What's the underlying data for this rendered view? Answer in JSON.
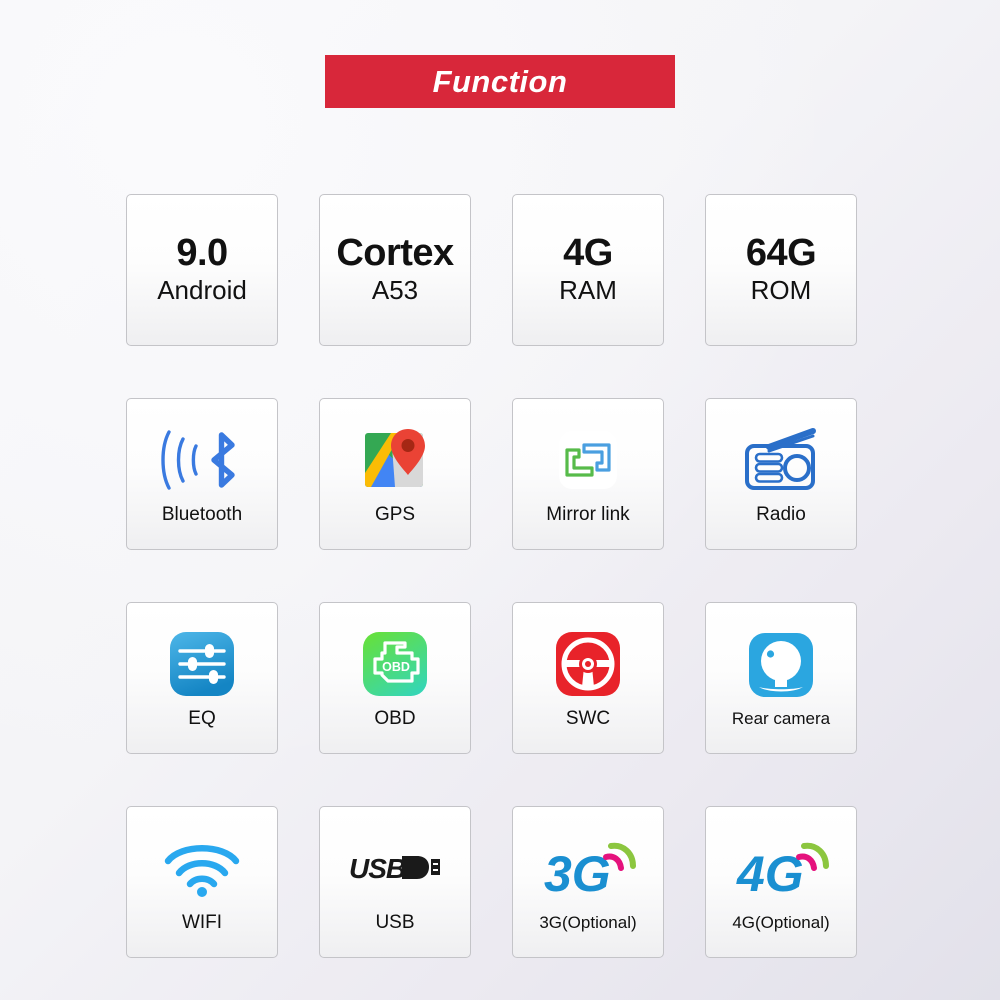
{
  "banner": {
    "title": "Function",
    "color": "#d8273a",
    "text_color": "#ffffff"
  },
  "page": {
    "background_from": "#f7f7f9",
    "background_to": "#e2e1ea",
    "card_border": "#c4c4c8"
  },
  "grid": {
    "columns": 4,
    "rows": 4,
    "cards": [
      {
        "kind": "text",
        "icon": "none",
        "big": "9.0",
        "sub": "Android",
        "label": ""
      },
      {
        "kind": "text",
        "icon": "none",
        "big": "Cortex",
        "sub": "A53",
        "label": ""
      },
      {
        "kind": "text",
        "icon": "none",
        "big": "4G",
        "sub": "RAM",
        "label": ""
      },
      {
        "kind": "text",
        "icon": "none",
        "big": "64G",
        "sub": "ROM",
        "label": ""
      },
      {
        "kind": "icon",
        "icon": "bluetooth-icon",
        "label": "Bluetooth",
        "color": "#3a7ae0"
      },
      {
        "kind": "icon",
        "icon": "gps-map-pin-icon",
        "label": "GPS",
        "color": "#34a853"
      },
      {
        "kind": "icon",
        "icon": "mirror-link-icon",
        "label": "Mirror link",
        "color": "#4a9fe0"
      },
      {
        "kind": "icon",
        "icon": "radio-icon",
        "label": "Radio",
        "color": "#2a6fc9"
      },
      {
        "kind": "icon",
        "icon": "eq-sliders-icon",
        "label": "EQ",
        "color": "#3fa9dd"
      },
      {
        "kind": "icon",
        "icon": "obd-engine-icon",
        "label": "OBD",
        "color": "#4ed760"
      },
      {
        "kind": "icon",
        "icon": "steering-wheel-icon",
        "label": "SWC",
        "color": "#e8232a"
      },
      {
        "kind": "icon",
        "icon": "rear-camera-icon",
        "label": "Rear camera",
        "color": "#2ba6e0"
      },
      {
        "kind": "icon",
        "icon": "wifi-icon",
        "label": "WIFI",
        "color": "#29a8ef"
      },
      {
        "kind": "icon",
        "icon": "usb-logo-icon",
        "label": "USB",
        "color": "#1a1a1a"
      },
      {
        "kind": "icon",
        "icon": "3g-signal-icon",
        "label": "3G",
        "optional": "(Optional)",
        "color": "#1a8fd1"
      },
      {
        "kind": "icon",
        "icon": "4g-signal-icon",
        "label": "4G",
        "optional": "(Optional)",
        "color": "#1a8fd1"
      }
    ]
  }
}
